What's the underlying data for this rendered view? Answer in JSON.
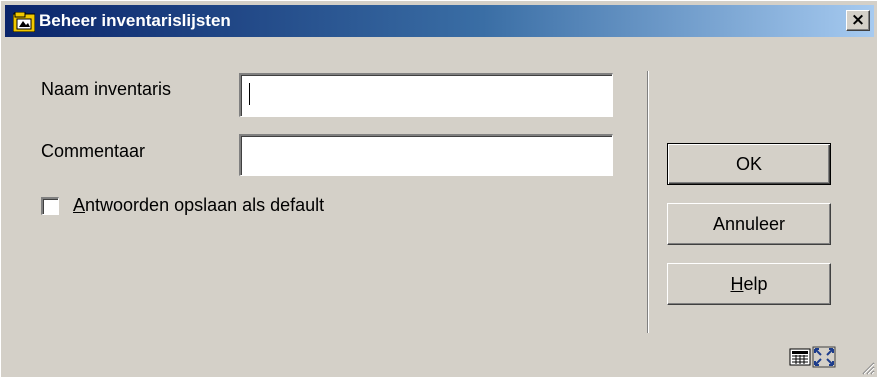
{
  "window": {
    "title": "Beheer inventarislijsten",
    "close_label": "×",
    "icon": "app-icon"
  },
  "form": {
    "name_label": "Naam inventaris",
    "name_value": "",
    "comment_label": "Commentaar",
    "comment_value": "",
    "checkbox_label_mnemonic": "A",
    "checkbox_label_rest": "ntwoorden opslaan als default",
    "checkbox_checked": false
  },
  "buttons": {
    "ok": "OK",
    "cancel": "Annuleer",
    "help_mnemonic": "H",
    "help_rest": "elp"
  },
  "status_bar": {
    "icons": [
      "keyboard-icon",
      "maximize-icon",
      "resize-grip-icon"
    ]
  },
  "colors": {
    "dialog_bg": "#d4d0c8",
    "title_start": "#0a246a",
    "title_end": "#a6caf0"
  }
}
